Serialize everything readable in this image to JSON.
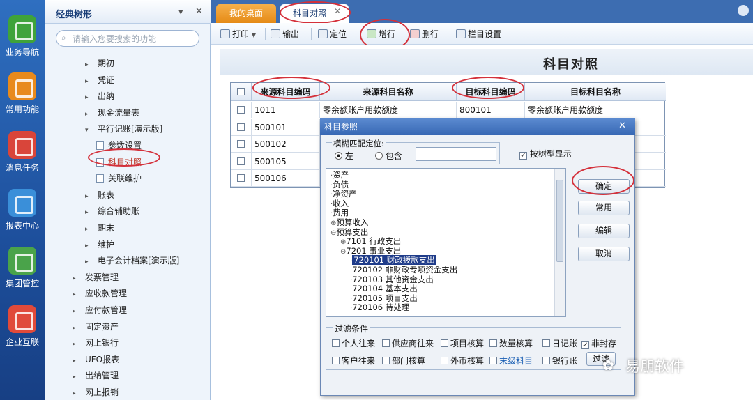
{
  "rail": {
    "items": [
      "业务导航",
      "常用功能",
      "消息任务",
      "报表中心",
      "集团管控",
      "企业互联"
    ]
  },
  "tree": {
    "title": "经典树形",
    "search_placeholder": "请输入您要搜索的功能",
    "items": [
      {
        "label": "期初",
        "level": 2
      },
      {
        "label": "凭证",
        "level": 2
      },
      {
        "label": "出纳",
        "level": 2
      },
      {
        "label": "现金流量表",
        "level": 2
      },
      {
        "label": "平行记账[演示版]",
        "level": 2,
        "expanded": true
      },
      {
        "label": "参数设置",
        "level": 3
      },
      {
        "label": "科目对照",
        "level": 3,
        "selected": true
      },
      {
        "label": "关联维护",
        "level": 3
      },
      {
        "label": "账表",
        "level": 2
      },
      {
        "label": "综合辅助账",
        "level": 2
      },
      {
        "label": "期末",
        "level": 2
      },
      {
        "label": "维护",
        "level": 2
      },
      {
        "label": "电子会计档案[演示版]",
        "level": 2
      },
      {
        "label": "发票管理",
        "level": 1
      },
      {
        "label": "应收款管理",
        "level": 1
      },
      {
        "label": "应付款管理",
        "level": 1
      },
      {
        "label": "固定资产",
        "level": 1
      },
      {
        "label": "网上银行",
        "level": 1
      },
      {
        "label": "UFO报表",
        "level": 1
      },
      {
        "label": "出纳管理",
        "level": 1
      },
      {
        "label": "网上报销",
        "level": 1
      }
    ]
  },
  "tabs": {
    "home": "我的桌面",
    "active": "科目对照",
    "close": "✕"
  },
  "toolbar": {
    "print": "打印",
    "export": "输出",
    "locate": "定位",
    "addrow": "增行",
    "delrow": "删行",
    "colset": "栏目设置"
  },
  "page_title": "科目对照",
  "grid": {
    "headers": [
      "来源科目编码",
      "来源科目名称",
      "目标科目编码",
      "目标科目名称"
    ],
    "rows": [
      {
        "src_code": "1011",
        "src_name": "零余额账户用款额度",
        "dst_code": "800101",
        "dst_name": "零余额账户用款额度"
      },
      {
        "src_code": "500101",
        "src_name": "",
        "dst_code": "",
        "dst_name": ""
      },
      {
        "src_code": "500102",
        "src_name": "",
        "dst_code": "",
        "dst_name": ""
      },
      {
        "src_code": "500105",
        "src_name": "",
        "dst_code": "",
        "dst_name": ""
      },
      {
        "src_code": "500106",
        "src_name": "",
        "dst_code": "",
        "dst_name": ""
      }
    ]
  },
  "dialog": {
    "title": "科目参照",
    "close": "✕",
    "match_label": "模糊匹配定位:",
    "left": "左",
    "contains": "包含",
    "tree_display": "按树型显示",
    "buttons": {
      "ok": "确定",
      "common": "常用",
      "edit": "编辑",
      "cancel": "取消"
    },
    "tree": [
      "资产",
      "负债",
      "净资产",
      "收入",
      "费用",
      "预算收入",
      "预算支出",
      "7101 行政支出",
      "7201 事业支出",
      "720101 财政拨款支出",
      "720102 非财政专项资金支出",
      "720103 其他资金支出",
      "720104 基本支出",
      "720105 项目支出",
      "720106 待处理"
    ],
    "filter": {
      "legend": "过滤条件",
      "row1": [
        "个人往来",
        "供应商往来",
        "项目核算",
        "数量核算",
        "日记账",
        "非封存"
      ],
      "row2": [
        "客户往来",
        "部门核算",
        "外币核算",
        "末级科目",
        "银行账"
      ],
      "filter_btn": "过滤"
    }
  },
  "watermark": "易朋软件"
}
